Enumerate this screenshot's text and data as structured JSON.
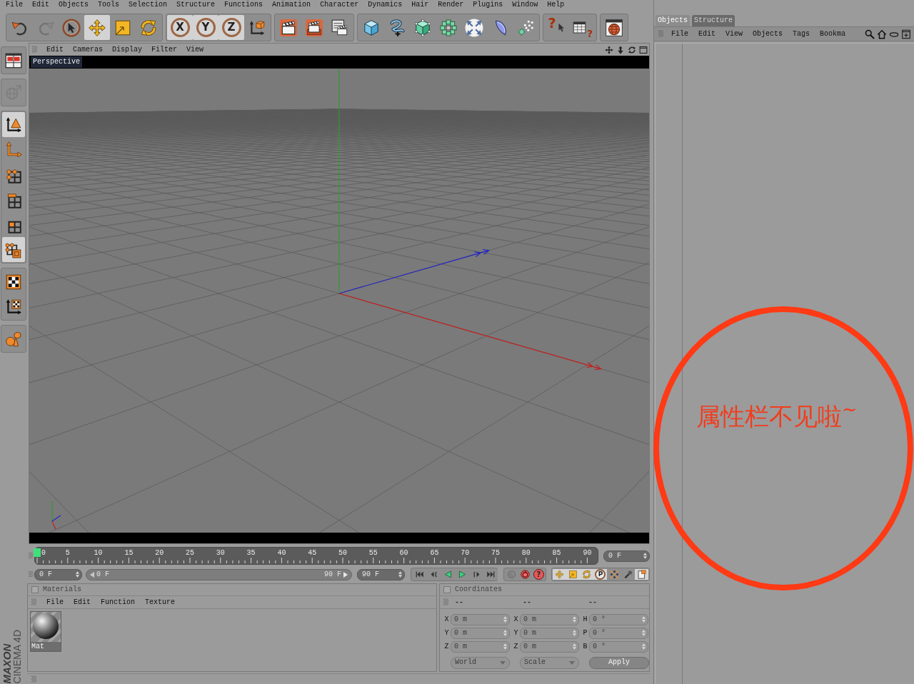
{
  "menubar": [
    "File",
    "Edit",
    "Objects",
    "Tools",
    "Selection",
    "Structure",
    "Functions",
    "Animation",
    "Character",
    "Dynamics",
    "Hair",
    "Render",
    "Plugins",
    "Window",
    "Help"
  ],
  "toolbar": [
    [
      {
        "selected": false,
        "disabled": false
      },
      {
        "selected": false,
        "disabled": true
      },
      {
        "selected": false,
        "disabled": false
      },
      {
        "selected": true,
        "disabled": false
      },
      {
        "selected": false,
        "disabled": false
      },
      {
        "selected": false,
        "disabled": false
      }
    ],
    [
      {
        "label": "X",
        "selected": true,
        "disabled": false
      },
      {
        "label": "Y",
        "selected": true,
        "disabled": false
      },
      {
        "label": "Z",
        "selected": true,
        "disabled": false
      },
      {
        "selected": false,
        "disabled": false
      }
    ],
    [
      {
        "selected": false,
        "disabled": false
      },
      {
        "selected": false,
        "disabled": false
      },
      {
        "selected": false,
        "disabled": false
      }
    ],
    [
      {
        "selected": false,
        "disabled": false
      },
      {
        "selected": false,
        "disabled": false
      },
      {
        "selected": false,
        "disabled": false
      },
      {
        "selected": false,
        "disabled": false
      },
      {
        "selected": false,
        "disabled": false
      },
      {
        "selected": false,
        "disabled": false
      },
      {
        "selected": false,
        "disabled": false
      }
    ],
    [
      {
        "label": "?",
        "selected": false,
        "disabled": false
      },
      {
        "label": "?",
        "selected": false,
        "disabled": false
      }
    ],
    [
      {
        "selected": false,
        "disabled": false
      }
    ]
  ],
  "mode_toolbar": [
    [
      {
        "selected": false,
        "disabled": false
      }
    ],
    [
      {
        "selected": false,
        "disabled": true
      }
    ],
    [
      {
        "selected": true,
        "disabled": false
      },
      {
        "selected": false,
        "disabled": false
      },
      {
        "selected": false,
        "disabled": false
      },
      {
        "selected": false,
        "disabled": false
      },
      {
        "selected": false,
        "disabled": false
      },
      {
        "selected": true,
        "disabled": false
      }
    ],
    [
      {
        "selected": false,
        "disabled": false
      },
      {
        "selected": false,
        "disabled": false
      }
    ],
    [
      {
        "selected": false,
        "disabled": false
      }
    ]
  ],
  "viewport": {
    "menu": [
      "Edit",
      "Cameras",
      "Display",
      "Filter",
      "View"
    ],
    "camera": "Perspective"
  },
  "timeline": {
    "ticks": [
      "0",
      "5",
      "10",
      "15",
      "20",
      "25",
      "30",
      "35",
      "40",
      "45",
      "50",
      "55",
      "60",
      "65",
      "70",
      "75",
      "80",
      "85",
      "90"
    ],
    "level": 0,
    "current_frame": "0 F"
  },
  "transport": {
    "start_frame": "0 F",
    "range_start": "0 F",
    "range_end": "90 F",
    "end_frame": "90 F",
    "groups": [
      [
        {
          "selected": false,
          "disabled": false
        },
        {
          "selected": false,
          "disabled": false
        },
        {
          "selected": false,
          "disabled": false
        },
        {
          "selected": false,
          "disabled": false
        },
        {
          "selected": false,
          "disabled": false
        },
        {
          "selected": false,
          "disabled": false
        }
      ],
      [
        {
          "selected": false,
          "disabled": true
        },
        {
          "selected": false,
          "disabled": false
        },
        {
          "label": "?",
          "selected": false,
          "disabled": false
        }
      ],
      [
        {
          "selected": true,
          "disabled": false
        },
        {
          "selected": true,
          "disabled": false
        },
        {
          "selected": true,
          "disabled": false
        },
        {
          "label": "P",
          "selected": true,
          "disabled": false
        },
        {
          "selected": false,
          "disabled": false
        },
        {
          "selected": false,
          "disabled": false
        },
        {
          "selected": true,
          "disabled": false
        }
      ]
    ]
  },
  "materials": {
    "title": "Materials",
    "checked": false,
    "menu": [
      "File",
      "Edit",
      "Function",
      "Texture"
    ],
    "items": [
      {
        "name": "Mat"
      }
    ]
  },
  "coordinates": {
    "title": "Coordinates",
    "checked": false,
    "disabled": true,
    "column_headers": [
      "--",
      "--",
      "--"
    ],
    "rows": [
      {
        "labels": [
          "X",
          "X",
          "H"
        ],
        "values": [
          "0 m",
          "0 m",
          "0 °"
        ]
      },
      {
        "labels": [
          "Y",
          "Y",
          "P"
        ],
        "values": [
          "0 m",
          "0 m",
          "0 °"
        ]
      },
      {
        "labels": [
          "Z",
          "Z",
          "B"
        ],
        "values": [
          "0 m",
          "0 m",
          "0 °"
        ]
      }
    ],
    "dropdowns": [
      "World",
      "Scale"
    ],
    "button": "Apply"
  },
  "object_manager": {
    "tabs": [
      {
        "label": "Objects",
        "selected": true
      },
      {
        "label": "Structure",
        "selected": false
      }
    ],
    "menu": [
      "File",
      "Edit",
      "View",
      "Objects",
      "Tags",
      "Bookma"
    ]
  },
  "annotation": {
    "text": "属性栏不见啦$^{~}$"
  },
  "logo": [
    "MAXON",
    "CINEMA 4D"
  ]
}
